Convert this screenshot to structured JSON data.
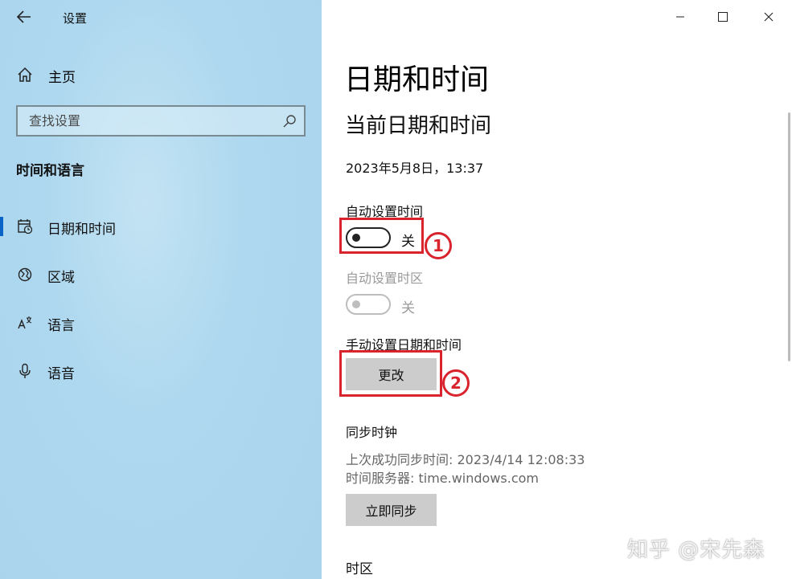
{
  "window": {
    "title": "设置"
  },
  "sidebar": {
    "home_label": "主页",
    "search_placeholder": "查找设置",
    "section_title": "时间和语言",
    "items": [
      {
        "label": "日期和时间",
        "icon": "calendar-clock-icon",
        "selected": true
      },
      {
        "label": "区域",
        "icon": "globe-icon",
        "selected": false
      },
      {
        "label": "语言",
        "icon": "language-icon",
        "selected": false
      },
      {
        "label": "语音",
        "icon": "microphone-icon",
        "selected": false
      }
    ],
    "accent_color": "#0a64c8"
  },
  "main": {
    "page_title": "日期和时间",
    "current_section": "当前日期和时间",
    "current_datetime": "2023年5月8日，13:37",
    "auto_time": {
      "label": "自动设置时间",
      "state": "关",
      "on": false
    },
    "auto_timezone": {
      "label": "自动设置时区",
      "state": "关",
      "on": false,
      "disabled": true
    },
    "manual": {
      "label": "手动设置日期和时间",
      "button": "更改"
    },
    "sync": {
      "title": "同步时钟",
      "last_sync": "上次成功同步时间: 2023/4/14 12:08:33",
      "server": "时间服务器: time.windows.com",
      "button": "立即同步"
    },
    "timezone_title": "时区"
  },
  "annotations": {
    "color": "#d9232d",
    "num1": "1",
    "num2": "2"
  },
  "watermark": "知乎 @宋先森"
}
